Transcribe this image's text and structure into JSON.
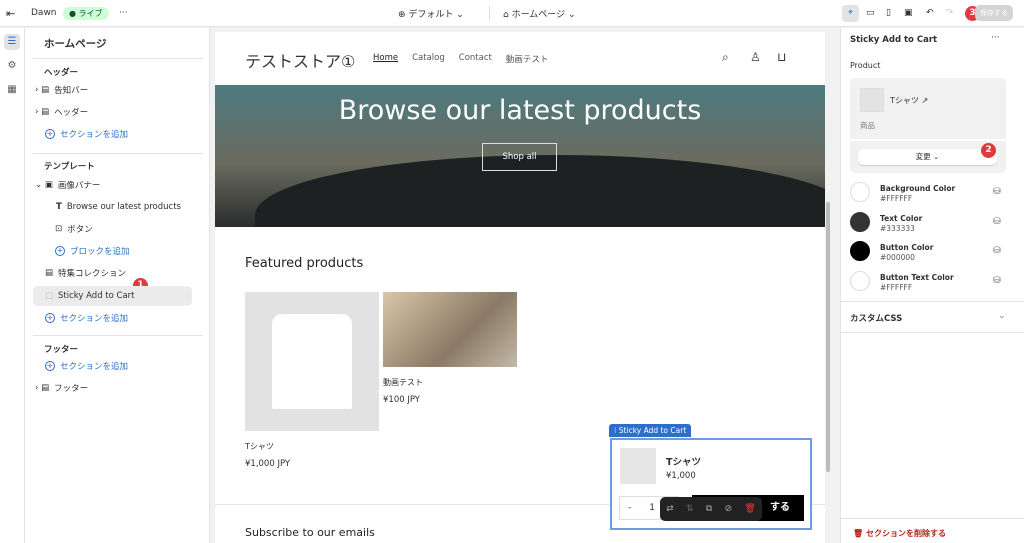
{
  "topbar": {
    "theme": "Dawn",
    "status": "ライブ",
    "more": "···",
    "preset": "デフォルト",
    "page": "ホームページ",
    "save": "保存する",
    "badge": "3"
  },
  "sidebar": {
    "title": "ホームページ",
    "header_group": "ヘッダー",
    "items_header": [
      "告知バー",
      "ヘッダー"
    ],
    "add_section": "セクションを追加",
    "template_group": "テンプレート",
    "banner": "画像バナー",
    "banner_blocks": [
      "Browse our latest products",
      "ボタン"
    ],
    "add_block": "ブロックを追加",
    "collection": "特集コレクション",
    "sticky": "Sticky Add to Cart",
    "sticky_badge": "1",
    "footer_group": "フッター",
    "footer": "フッター"
  },
  "store": {
    "name": "テストストア①",
    "nav": [
      "Home",
      "Catalog",
      "Contact",
      "動画テスト"
    ],
    "banner_title": "Browse our latest products",
    "shop_all": "Shop all",
    "featured": "Featured products",
    "products": [
      {
        "name": "Tシャツ",
        "price": "¥1,000 JPY"
      },
      {
        "name": "動画テスト",
        "price": "¥100 JPY"
      }
    ],
    "subscribe": "Subscribe to our emails"
  },
  "sticky": {
    "tag": "Sticky Add to Cart",
    "name": "Tシャツ",
    "price": "¥1,000",
    "qty_minus": "-",
    "qty": "1",
    "button": "する"
  },
  "panel": {
    "title": "Sticky Add to Cart",
    "more": "···",
    "product_label": "Product",
    "product_name": "Tシャツ",
    "product_type": "商品",
    "change": "変更",
    "change_badge": "2",
    "colors": [
      {
        "label": "Background Color",
        "value": "#FFFFFF"
      },
      {
        "label": "Text Color",
        "value": "#333333"
      },
      {
        "label": "Button Color",
        "value": "#000000"
      },
      {
        "label": "Button Text Color",
        "value": "#FFFFFF"
      }
    ],
    "custom_css": "カスタムCSS",
    "delete": "セクションを削除する"
  }
}
